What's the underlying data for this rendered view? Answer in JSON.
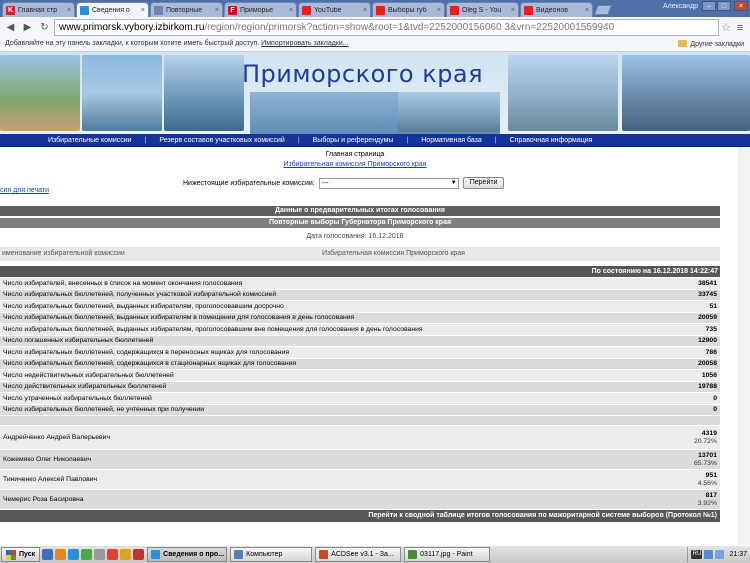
{
  "browser": {
    "tabs": [
      {
        "label": "Главная стр",
        "icon": "k-icon",
        "color": "#d9252a",
        "glyph": "K",
        "active": false
      },
      {
        "label": "Сведения о",
        "icon": "chrome-icon",
        "color": "#2a8fd6",
        "glyph": "",
        "active": true
      },
      {
        "label": "Повторные",
        "icon": "page-icon",
        "color": "#6d84b3",
        "glyph": "",
        "active": false
      },
      {
        "label": "Приморье",
        "icon": "f-icon",
        "color": "#c4161c",
        "glyph": "F",
        "active": false
      },
      {
        "label": "YouTube",
        "icon": "youtube-icon",
        "color": "#e62117",
        "glyph": "",
        "active": false
      },
      {
        "label": "Выборы губ",
        "icon": "youtube-icon",
        "color": "#e62117",
        "glyph": "",
        "active": false
      },
      {
        "label": "Oleg S - You",
        "icon": "youtube-icon",
        "color": "#e62117",
        "glyph": "",
        "active": false
      },
      {
        "label": "Видеонов",
        "icon": "youtube-icon",
        "color": "#e62117",
        "glyph": "",
        "active": false
      }
    ],
    "user": "Александр",
    "url_host": "www.primorsk.vybory.izbirkom.ru",
    "url_path": "/region/region/primorsk?action=show&root=1&tvd=2252000156060 3&vrn=22520001559940",
    "bookmarks_prompt": "Добавляйте на эту панель закладки, к которым хотите иметь быстрый доступ.",
    "bookmarks_import": "Импортировать закладки...",
    "other_bookmarks": "Другие закладки"
  },
  "banner": {
    "title": "Приморского края"
  },
  "menu": [
    "Избирательные комиссии",
    "Резерв составов участковых комиссий",
    "Выборы и референдумы",
    "Нормативная база",
    "Справочная информация"
  ],
  "page": {
    "home": "Главная страница",
    "commission_link": "Избирательная комиссия Приморского края",
    "filter_label": "Нижестоящие избирательные комиссии:",
    "filter_value": "---",
    "go_button": "Перейти",
    "print_link": "сия для печати",
    "header1": "Данные о предварительных итогах голосования",
    "header2": "Повторные выборы Губернатора Приморского края",
    "date_line": "Дата голосования:  16.12.2018",
    "col_commission": "именование избирательной комиссии",
    "commission_name": "Избирательная комиссия Приморского края",
    "status": "По состоянию на 16.12.2018 14:22:47",
    "footer": "Перейти к сводной таблице итогов голосования по мажоритарной системе выборов (Протокол №1)"
  },
  "rows": [
    {
      "label": "Число избирателей, внесенных в список на момент окончания голосования",
      "value": "38541"
    },
    {
      "label": "Число избирательных бюллетеней, полученных участковой избирательной комиссией",
      "value": "33745"
    },
    {
      "label": "Число избирательных бюллетеней, выданных избирателям, проголосовавшим досрочно",
      "value": "51"
    },
    {
      "label": "Число избирательных бюллетеней, выданных избирателям в помещении для голосования в день голосования",
      "value": "20059"
    },
    {
      "label": "Число избирательных бюллетеней, выданных избирателям, проголосовавшим вне помещения для голосования в день голосования",
      "value": "735"
    },
    {
      "label": "Число погашенных избирательных бюллетеней",
      "value": "12900"
    },
    {
      "label": "Число избирательных бюллетеней, содержащихся в переносных ящиках для голосования",
      "value": "786"
    },
    {
      "label": "Число избирательных бюллетеней, содержащихся в стационарных ящиках для голосования",
      "value": "20058"
    },
    {
      "label": "Число недействительных избирательных бюллетеней",
      "value": "1056"
    },
    {
      "label": "Число действительных избирательных бюллетеней",
      "value": "19788"
    },
    {
      "label": "Число утраченных избирательных бюллетеней",
      "value": "0"
    },
    {
      "label": "Число избирательных бюллетеней, не учтенных при получении",
      "value": "0"
    }
  ],
  "candidates": [
    {
      "name": "Андрейченко Андрей Валерьевич",
      "votes": "4319",
      "percent": "20.72%"
    },
    {
      "name": "Кожемяко Олег Николаевич",
      "votes": "13701",
      "percent": "65.73%"
    },
    {
      "name": "Тиниченко Алексей Павлович",
      "votes": "951",
      "percent": "4.56%"
    },
    {
      "name": "Чемерис Роза Басировна",
      "votes": "817",
      "percent": "3.92%"
    }
  ],
  "taskbar": {
    "start": "Пуск",
    "windows": [
      {
        "label": "Сведения о про...",
        "icon": "chrome-icon",
        "color": "#2a8fd6",
        "active": true
      },
      {
        "label": "Компьютер",
        "icon": "computer-icon",
        "color": "#5a7fb8",
        "active": false
      },
      {
        "label": "ACDSee v3.1 - За...",
        "icon": "acdsee-icon",
        "color": "#c94a2a",
        "active": false
      },
      {
        "label": "03117.jpg - Paint",
        "icon": "paint-icon",
        "color": "#4a8a3a",
        "active": false
      }
    ],
    "tray_lang": "RU",
    "clock": "21:37"
  }
}
